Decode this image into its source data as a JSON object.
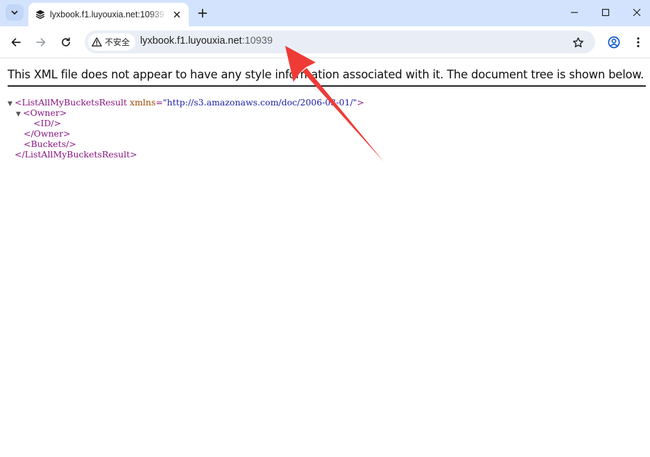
{
  "tab": {
    "title": "lyxbook.f1.luyouxia.net:10939",
    "close_glyph": "✕"
  },
  "toolbar": {
    "security_label": "不安全",
    "url_host": "lyxbook.f1.luyouxia.net",
    "url_port": ":10939"
  },
  "page": {
    "info_text": "This XML file does not appear to have any style information associated with it. The document tree is shown below.",
    "xml": {
      "root_open": "<ListAllMyBucketsResult",
      "root_attr_name": "xmlns",
      "root_attr_value": "\"http://s3.amazonaws.com/doc/2006-03-01/\"",
      "root_open_end": ">",
      "owner_open": "<Owner>",
      "id_empty": "<ID/>",
      "owner_close": "</Owner>",
      "buckets_empty": "<Buckets/>",
      "root_close": "</ListAllMyBucketsResult>"
    }
  },
  "colors": {
    "tabstrip": "#d3e3fd",
    "omnibox": "#e9eef6",
    "xml_tag": "#881280",
    "xml_attr": "#994500",
    "xml_value": "#1a1aa6",
    "annotation_arrow": "#ef3b36"
  },
  "icons": {
    "tab_search": "chevron-down-icon",
    "favicon": "layers-icon",
    "new_tab": "plus-icon",
    "minimize": "minimize-icon",
    "maximize": "maximize-icon",
    "close_window": "close-icon",
    "back": "arrow-left-icon",
    "forward": "arrow-right-icon",
    "reload": "reload-icon",
    "not_secure": "warning-triangle-icon",
    "bookmark": "star-icon",
    "profile": "profile-icon",
    "menu": "kebab-menu-icon"
  }
}
